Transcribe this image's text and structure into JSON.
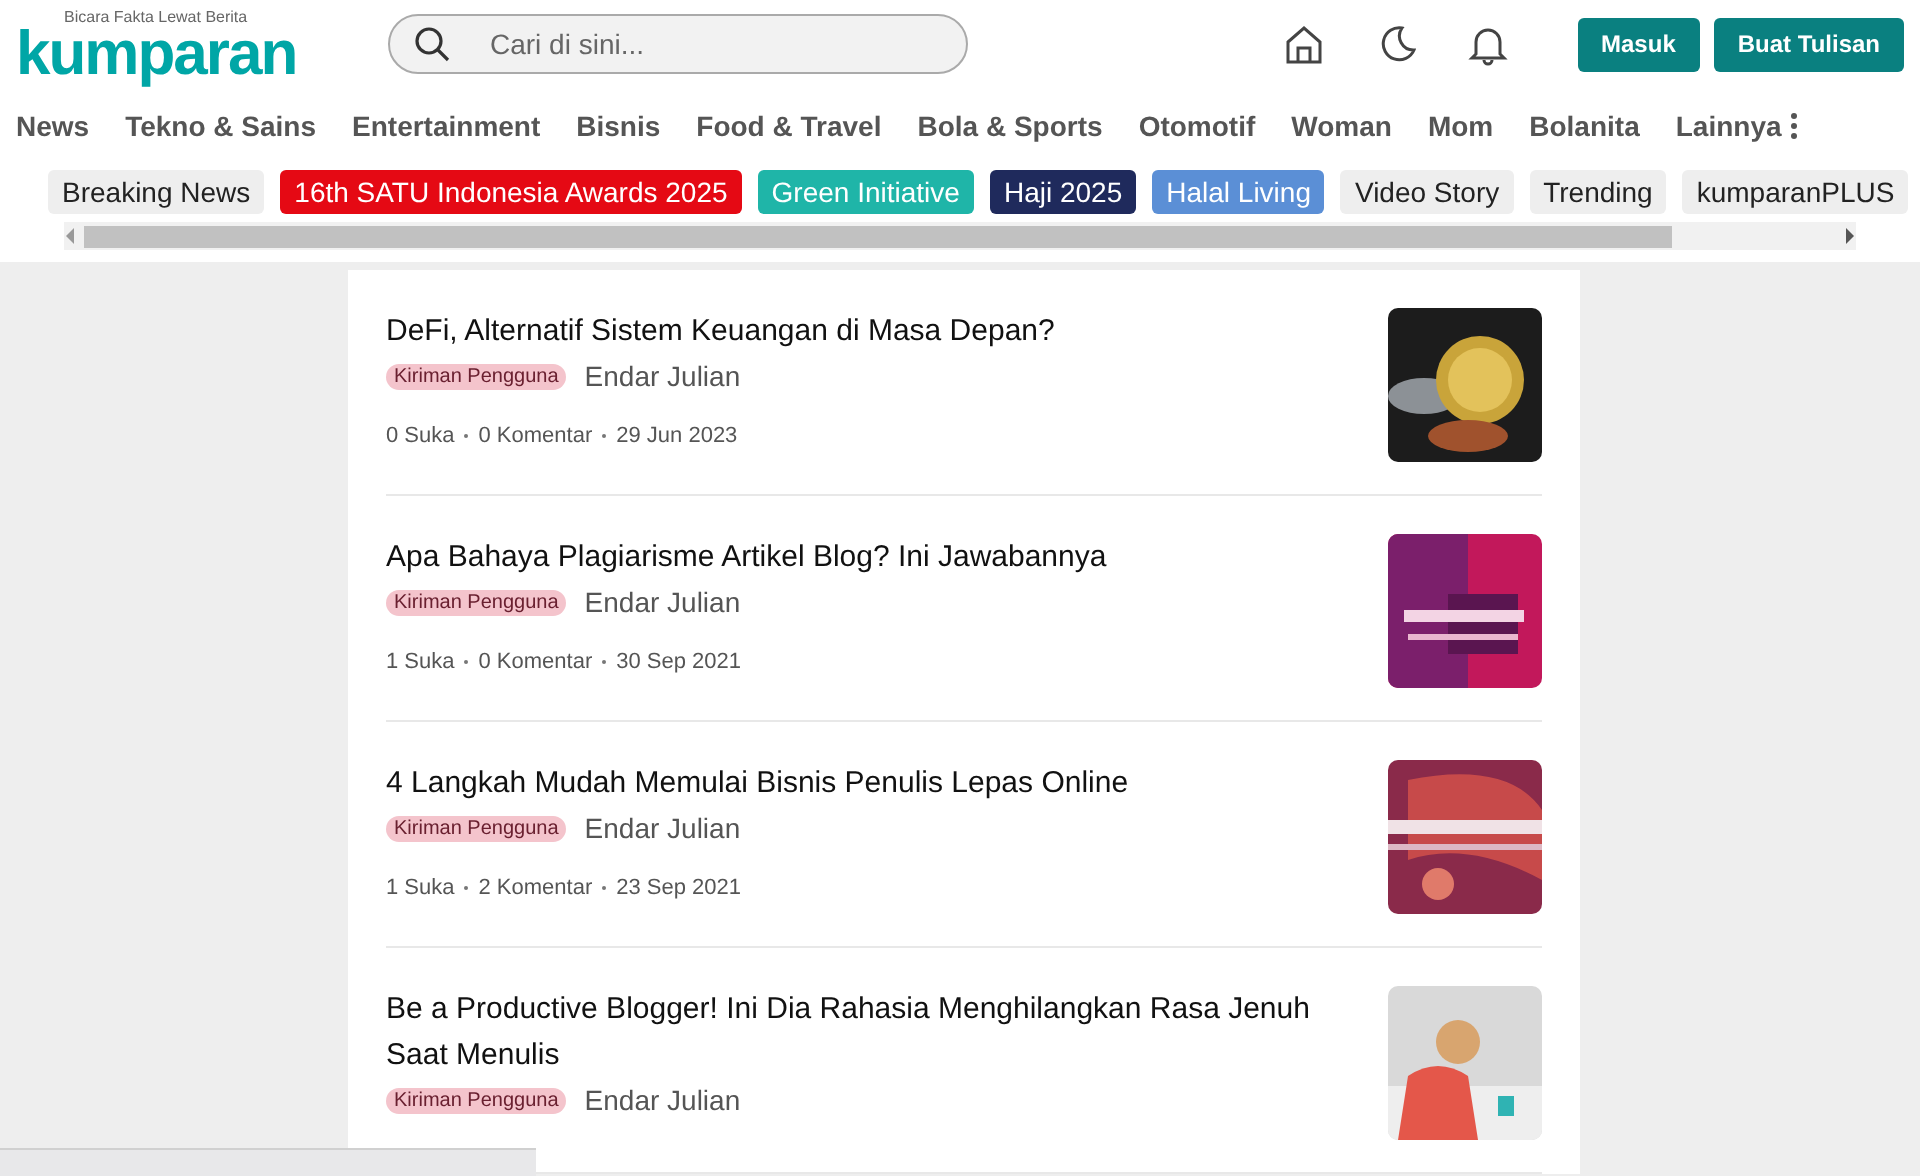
{
  "header": {
    "logo_tagline": "Bicara Fakta Lewat Berita",
    "logo": "kumparan",
    "search": {
      "placeholder": "Cari di sini..."
    },
    "buttons": [
      {
        "label": "Masuk"
      },
      {
        "label": "Buat Tulisan"
      }
    ]
  },
  "nav": {
    "items": [
      "News",
      "Tekno & Sains",
      "Entertainment",
      "Bisnis",
      "Food & Travel",
      "Bola & Sports",
      "Otomotif",
      "Woman",
      "Mom",
      "Bolanita",
      "Lainnya"
    ]
  },
  "tags": [
    {
      "label": "Breaking News",
      "color": "#eeeeee"
    },
    {
      "label": "16th SATU Indonesia Awards 2025",
      "color": "#e50914"
    },
    {
      "label": "Green Initiative",
      "color": "#1fb5a8"
    },
    {
      "label": "Haji 2025",
      "color": "#1f2a5c"
    },
    {
      "label": "Halal Living",
      "color": "#5b8fd6"
    },
    {
      "label": "Video Story",
      "color": "#eeeeee"
    },
    {
      "label": "Trending",
      "color": "#eeeeee"
    },
    {
      "label": "kumparanPLUS",
      "color": "#eeeeee"
    }
  ],
  "articles": [
    {
      "title": "DeFi, Alternatif Sistem Keuangan di Masa Depan?",
      "badge": "Kiriman Pengguna",
      "author": "Endar Julian",
      "meta": [
        "0 Suka",
        "0 Komentar",
        "29 Jun 2023"
      ],
      "thumbnail": {
        "kind": "picture"
      }
    },
    {
      "title": "Apa Bahaya Plagiarisme Artikel Blog? Ini Jawabannya",
      "badge": "Kiriman Pengguna",
      "author": "Endar Julian",
      "meta": [
        "1 Suka",
        "0 Komentar",
        "30 Sep 2021"
      ],
      "thumbnail": {
        "kind": "picture"
      }
    },
    {
      "title": "4 Langkah Mudah Memulai Bisnis Penulis Lepas Online",
      "badge": "Kiriman Pengguna",
      "author": "Endar Julian",
      "meta": [
        "1 Suka",
        "2 Komentar",
        "23 Sep 2021"
      ],
      "thumbnail": {
        "kind": "picture"
      }
    },
    {
      "title": "Be a Productive Blogger! Ini Dia Rahasia Menghilangkan Rasa Jenuh Saat Menulis",
      "badge": "Kiriman Pengguna",
      "author": "Endar Julian",
      "thumbnail": {
        "kind": "picture"
      }
    }
  ]
}
